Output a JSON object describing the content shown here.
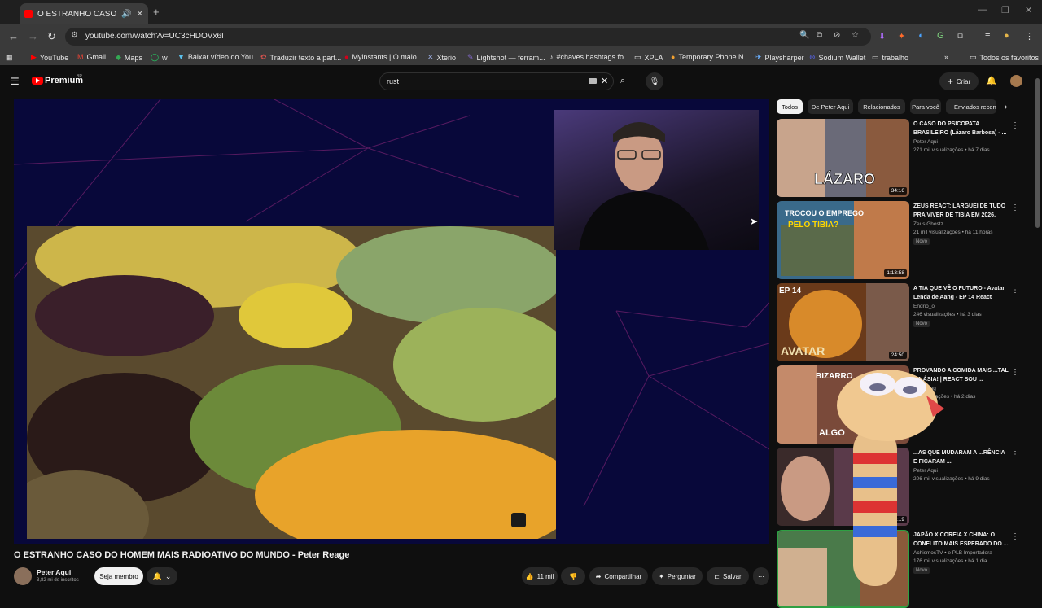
{
  "browser": {
    "tab_title": "O ESTRANHO CASO DO HOMEM",
    "url": "youtube.com/watch?v=UC3cHDOVx6I",
    "bookmarks": [
      {
        "label": "YouTube",
        "icon": "youtube-icon"
      },
      {
        "label": "Gmail",
        "icon": "gmail-icon"
      },
      {
        "label": "Maps",
        "icon": "maps-icon"
      },
      {
        "label": "w",
        "icon": "whatsapp-icon"
      },
      {
        "label": "Baixar vídeo do You...",
        "icon": "download-icon"
      },
      {
        "label": "Traduzir texto a part...",
        "icon": "translate-icon"
      },
      {
        "label": "Myinstants | O maio...",
        "icon": "myinstants-icon"
      },
      {
        "label": "Xterio",
        "icon": "xterio-icon"
      },
      {
        "label": "Lightshot — ferram...",
        "icon": "lightshot-icon"
      },
      {
        "label": "#chaves hashtags fo...",
        "icon": "tiktok-icon"
      },
      {
        "label": "XPLA",
        "icon": "folder-icon"
      },
      {
        "label": "Temporary Phone N...",
        "icon": "phone-icon"
      },
      {
        "label": "Playsharper",
        "icon": "playsharper-icon"
      },
      {
        "label": "Sodium Wallet",
        "icon": "wallet-icon"
      },
      {
        "label": "trabalho",
        "icon": "folder-icon"
      }
    ],
    "other_bookmarks": "Todos os favoritos"
  },
  "youtube": {
    "logo_text": "Premium",
    "logo_region": "BR",
    "search_value": "rust",
    "create_label": "Criar",
    "video": {
      "title": "O ESTRANHO CASO DO HOMEM MAIS RADIOATIVO DO MUNDO - Peter Reage",
      "channel": "Peter Aqui",
      "subscribers": "3,82 mi de inscritos",
      "member_label": "Seja membro",
      "likes": "11 mil",
      "share_label": "Compartilhar",
      "ask_label": "Perguntar",
      "save_label": "Salvar"
    },
    "chips": [
      "Todos",
      "De Peter Aqui",
      "Relacionados",
      "Para você",
      "Enviados recentemente"
    ],
    "recommendations": [
      {
        "title": "O CASO DO PSICOPATA BRASILEIRO (Lázaro Barbosa) - ...",
        "channel": "Peter Aqui",
        "meta": "271 mil visualizações • há 7 dias",
        "duration": "34:16",
        "badge": ""
      },
      {
        "title": "ZEUS REACT: LARGUEI DE TUDO PRA VIVER DE TIBIA EM 2026.",
        "channel": "Zeus Ghostz",
        "meta": "21 mil visualizações • há 11 horas",
        "duration": "1:13:58",
        "badge": "Novo"
      },
      {
        "title": "A TIA QUE VÊ O FUTURO - Avatar Lenda de Aang - EP 14 React",
        "channel": "Endrio_o",
        "meta": "246 visualizações • há 3 dias",
        "duration": "24:50",
        "badge": "Novo"
      },
      {
        "title": "PROVANDO A COMIDA MAIS ...TAL DA ÁSIA! | REACT SOU ...",
        "channel": "...do Stag",
        "meta": "...visualizações • há 2 dias",
        "duration": "",
        "badge": ""
      },
      {
        "title": "...AS QUE MUDARAM A ...RÊNCIA E FICARAM ...",
        "channel": "Peter Aqui",
        "meta": "206 mil visualizações • há 9 dias",
        "duration": "37:19",
        "badge": ""
      },
      {
        "title": "JAPÃO X COREIA X CHINA: O CONFLITO MAIS ESPERADO DO ...",
        "channel": "AchismosTV • e PLB Importadora",
        "meta": "176 mil visualizações • há 1 dia",
        "duration": "",
        "badge": "Novo"
      }
    ]
  },
  "colors": {
    "accent": "#ff0000",
    "bg": "#0f0f0f",
    "chip": "#272727"
  }
}
